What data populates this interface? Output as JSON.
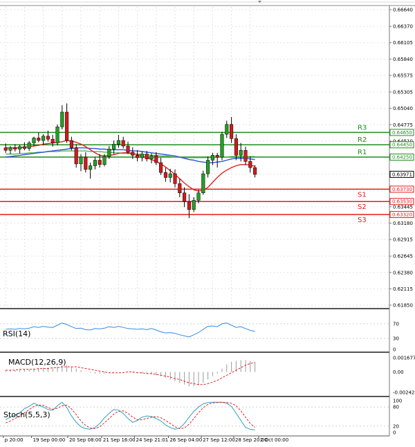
{
  "chart_data": {
    "type": "candlestick",
    "main": {
      "y_ticks": [
        "0.66640",
        "0.66370",
        "0.66105",
        "0.65840",
        "0.65575",
        "0.65305",
        "0.65040",
        "0.64775",
        "0.64510",
        "0.64245",
        "0.63975",
        "0.63710",
        "0.63445",
        "0.63180",
        "0.62915",
        "0.62645",
        "0.62380",
        "0.62115",
        "0.61850"
      ],
      "ylim": [
        0.6185,
        0.6664
      ],
      "current_price": "0.63971",
      "levels": [
        {
          "name": "R3",
          "value": 0.6465,
          "label": "0.64650",
          "color": "#1f8c1f"
        },
        {
          "name": "R2",
          "value": 0.6445,
          "label": "0.64450",
          "color": "#1f8c1f"
        },
        {
          "name": "R1",
          "value": 0.6425,
          "label": "0.64250",
          "color": "#1f8c1f"
        },
        {
          "name": "S1",
          "value": 0.6373,
          "label": "0.63730",
          "color": "#e31a1a"
        },
        {
          "name": "S2",
          "value": 0.6353,
          "label": "0.63530",
          "color": "#e31a1a"
        },
        {
          "name": "S3",
          "value": 0.6332,
          "label": "0.63320",
          "color": "#e31a1a"
        }
      ],
      "candles": [
        [
          0.644,
          0.6447,
          0.6432,
          0.6436
        ],
        [
          0.6436,
          0.6443,
          0.643,
          0.644
        ],
        [
          0.644,
          0.6446,
          0.6434,
          0.6438
        ],
        [
          0.6438,
          0.6445,
          0.6431,
          0.6442
        ],
        [
          0.6442,
          0.6449,
          0.6436,
          0.6439
        ],
        [
          0.6439,
          0.6451,
          0.6435,
          0.6448
        ],
        [
          0.6448,
          0.6458,
          0.6443,
          0.6456
        ],
        [
          0.6456,
          0.6465,
          0.6449,
          0.6452
        ],
        [
          0.6452,
          0.6462,
          0.6445,
          0.6459
        ],
        [
          0.6459,
          0.6468,
          0.645,
          0.6454
        ],
        [
          0.6454,
          0.6461,
          0.6442,
          0.6448
        ],
        [
          0.6448,
          0.6478,
          0.6444,
          0.6474
        ],
        [
          0.6474,
          0.6509,
          0.647,
          0.6498
        ],
        [
          0.6498,
          0.6512,
          0.6448,
          0.6452
        ],
        [
          0.6452,
          0.6458,
          0.6436,
          0.644
        ],
        [
          0.644,
          0.6446,
          0.6408,
          0.6414
        ],
        [
          0.6414,
          0.643,
          0.6402,
          0.6425
        ],
        [
          0.6425,
          0.6433,
          0.64,
          0.6405
        ],
        [
          0.6405,
          0.6416,
          0.639,
          0.6411
        ],
        [
          0.6411,
          0.6425,
          0.6405,
          0.642
        ],
        [
          0.642,
          0.643,
          0.6408,
          0.6413
        ],
        [
          0.6413,
          0.643,
          0.641,
          0.6426
        ],
        [
          0.6426,
          0.6443,
          0.6422,
          0.6438
        ],
        [
          0.6438,
          0.6452,
          0.643,
          0.6446
        ],
        [
          0.6446,
          0.6461,
          0.644,
          0.6452
        ],
        [
          0.6452,
          0.6458,
          0.6439,
          0.6443
        ],
        [
          0.6443,
          0.645,
          0.643,
          0.6433
        ],
        [
          0.6433,
          0.6441,
          0.6422,
          0.6428
        ],
        [
          0.6428,
          0.6436,
          0.6418,
          0.6424
        ],
        [
          0.6424,
          0.6434,
          0.6418,
          0.643
        ],
        [
          0.643,
          0.6435,
          0.6418,
          0.6422
        ],
        [
          0.6422,
          0.6431,
          0.6415,
          0.6427
        ],
        [
          0.6427,
          0.6433,
          0.6412,
          0.6416
        ],
        [
          0.6416,
          0.6424,
          0.6396,
          0.64
        ],
        [
          0.64,
          0.6408,
          0.6385,
          0.6392
        ],
        [
          0.6392,
          0.6406,
          0.6384,
          0.6398
        ],
        [
          0.6398,
          0.6405,
          0.6376,
          0.6382
        ],
        [
          0.6382,
          0.639,
          0.636,
          0.6367
        ],
        [
          0.6367,
          0.6376,
          0.6344,
          0.6353
        ],
        [
          0.6353,
          0.6365,
          0.6326,
          0.634
        ],
        [
          0.634,
          0.636,
          0.6336,
          0.6355
        ],
        [
          0.6355,
          0.6372,
          0.635,
          0.6367
        ],
        [
          0.6367,
          0.6403,
          0.6364,
          0.6398
        ],
        [
          0.6398,
          0.6426,
          0.6392,
          0.642
        ],
        [
          0.642,
          0.6432,
          0.6412,
          0.6428
        ],
        [
          0.6428,
          0.6432,
          0.6408,
          0.6425
        ],
        [
          0.6425,
          0.6466,
          0.642,
          0.6462
        ],
        [
          0.6462,
          0.6484,
          0.6456,
          0.6478
        ],
        [
          0.6478,
          0.649,
          0.6448,
          0.6455
        ],
        [
          0.6455,
          0.6462,
          0.642,
          0.6428
        ],
        [
          0.6428,
          0.6448,
          0.6418,
          0.6436
        ],
        [
          0.6436,
          0.6442,
          0.6412,
          0.6418
        ],
        [
          0.6418,
          0.6426,
          0.64,
          0.6408
        ],
        [
          0.6408,
          0.6412,
          0.6392,
          0.6397
        ]
      ],
      "ma_red": [
        0.644,
        0.644,
        0.644,
        0.644,
        0.6441,
        0.6442,
        0.6443,
        0.6444,
        0.6446,
        0.6447,
        0.6448,
        0.6449,
        0.645,
        0.6452,
        0.6451,
        0.6449,
        0.6446,
        0.6442,
        0.6437,
        0.6432,
        0.6428,
        0.6427,
        0.6428,
        0.6429,
        0.6431,
        0.6432,
        0.6432,
        0.6431,
        0.6429,
        0.6427,
        0.6424,
        0.6421,
        0.6418,
        0.6414,
        0.6409,
        0.6403,
        0.6397,
        0.639,
        0.6383,
        0.6377,
        0.6372,
        0.637,
        0.6371,
        0.6376,
        0.6384,
        0.6392,
        0.6399,
        0.6404,
        0.6408,
        0.6411,
        0.6413,
        0.6413,
        0.6412,
        0.641
      ],
      "ma_blue": [
        0.6425,
        0.6426,
        0.6427,
        0.6428,
        0.6429,
        0.643,
        0.6431,
        0.6432,
        0.6433,
        0.6434,
        0.6435,
        0.6436,
        0.6437,
        0.6438,
        0.6439,
        0.644,
        0.644,
        0.644,
        0.6439,
        0.6439,
        0.6438,
        0.6438,
        0.6437,
        0.6437,
        0.6437,
        0.6437,
        0.6436,
        0.6435,
        0.6435,
        0.6434,
        0.6433,
        0.6432,
        0.6431,
        0.643,
        0.6429,
        0.6428,
        0.6427,
        0.6425,
        0.6423,
        0.6421,
        0.642,
        0.6418,
        0.6417,
        0.6416,
        0.6416,
        0.6417,
        0.6418,
        0.642,
        0.6422,
        0.6423,
        0.6423,
        0.6423,
        0.6422,
        0.6421
      ],
      "ma_green": [
        0.643,
        0.643,
        0.643,
        0.6431,
        0.6431,
        0.6432,
        0.6432,
        0.6433,
        0.6433,
        0.6434,
        0.6434,
        0.6434,
        0.6435,
        0.6435,
        0.6435,
        0.6435,
        0.6435,
        0.6435,
        0.6434,
        0.6434,
        0.6434,
        0.6433,
        0.6433,
        0.6432,
        0.6432,
        0.6431,
        0.6431,
        0.643,
        0.643,
        0.6429,
        0.6429,
        0.6428,
        0.6428,
        0.6427,
        0.6427,
        0.6426,
        0.6425,
        0.6425,
        0.6424,
        0.6424,
        0.6424,
        0.6424,
        0.6424,
        0.6424,
        0.6424,
        0.6425,
        0.6425,
        0.6425,
        0.6426,
        0.6426,
        0.6426,
        0.6426,
        0.6426,
        0.6426
      ]
    },
    "rsi": {
      "label": "RSI(14)",
      "ticks": [
        "70",
        "30",
        "0"
      ],
      "ylim": [
        0,
        100
      ],
      "values": [
        55,
        56,
        55,
        57,
        56,
        58,
        62,
        60,
        63,
        61,
        60,
        66,
        72,
        68,
        62,
        57,
        58,
        54,
        53,
        57,
        56,
        58,
        62,
        60,
        63,
        60,
        57,
        56,
        55,
        56,
        54,
        57,
        53,
        48,
        45,
        46,
        44,
        40,
        37,
        34,
        40,
        46,
        55,
        63,
        64,
        62,
        70,
        72,
        66,
        60,
        62,
        57,
        52,
        49
      ]
    },
    "macd": {
      "label": "MACD(12,26,9)",
      "ticks": [
        "0.001677",
        "0.00",
        "-0.002421"
      ],
      "ylim": [
        -0.002421,
        0.001677
      ],
      "histogram": [
        0.0002,
        0.0002,
        0.0002,
        0.0003,
        0.0003,
        0.0003,
        0.0004,
        0.0004,
        0.0005,
        0.0005,
        0.0005,
        0.0006,
        0.0008,
        0.0008,
        0.0006,
        0.0004,
        0.0002,
        0.0,
        -0.0001,
        -0.0002,
        -0.0002,
        -0.0002,
        -0.0001,
        -0.0001,
        0.0,
        0.0,
        0.0,
        -0.0001,
        -0.0001,
        -0.0002,
        -0.0002,
        -0.0003,
        -0.0004,
        -0.0005,
        -0.0007,
        -0.0009,
        -0.0011,
        -0.0013,
        -0.0015,
        -0.0017,
        -0.0017,
        -0.0016,
        -0.0013,
        -0.0009,
        -0.0005,
        -0.0002,
        0.0004,
        0.0009,
        0.0012,
        0.0013,
        0.0014,
        0.0014,
        0.0013,
        0.0012
      ],
      "signal": [
        0.0002,
        0.0002,
        0.0002,
        0.0003,
        0.0003,
        0.0003,
        0.0003,
        0.0004,
        0.0004,
        0.0004,
        0.0005,
        0.0005,
        0.0006,
        0.0006,
        0.0006,
        0.0006,
        0.0005,
        0.0004,
        0.0003,
        0.0002,
        0.0001,
        0.0,
        -0.0001,
        -0.0001,
        -0.0001,
        -0.0001,
        0.0,
        0.0,
        -0.0001,
        -0.0001,
        -0.0002,
        -0.0002,
        -0.0003,
        -0.0004,
        -0.0005,
        -0.0006,
        -0.0008,
        -0.0009,
        -0.0011,
        -0.0013,
        -0.0014,
        -0.0015,
        -0.0015,
        -0.0014,
        -0.0012,
        -0.001,
        -0.0007,
        -0.0004,
        -0.0001,
        0.0002,
        0.0005,
        0.0008,
        0.001,
        0.0011
      ]
    },
    "stoch": {
      "label": "Stoch(5,5,3)",
      "ticks": [
        "100",
        "80",
        "20",
        "0"
      ],
      "ylim": [
        0,
        100
      ],
      "main": [
        40,
        48,
        55,
        62,
        75,
        82,
        92,
        85,
        80,
        72,
        70,
        84,
        95,
        78,
        52,
        32,
        18,
        12,
        10,
        16,
        28,
        46,
        60,
        72,
        70,
        60,
        44,
        32,
        38,
        48,
        52,
        50,
        44,
        36,
        24,
        15,
        10,
        14,
        28,
        48,
        66,
        80,
        90,
        94,
        95,
        95,
        95,
        92,
        82,
        60,
        38,
        16,
        10,
        8
      ],
      "signal": [
        30,
        36,
        44,
        52,
        62,
        72,
        82,
        86,
        85,
        78,
        73,
        76,
        84,
        86,
        74,
        56,
        36,
        22,
        14,
        12,
        18,
        30,
        44,
        58,
        66,
        68,
        60,
        48,
        40,
        40,
        44,
        48,
        50,
        46,
        38,
        28,
        18,
        12,
        14,
        26,
        44,
        62,
        78,
        88,
        93,
        94,
        95,
        94,
        92,
        84,
        68,
        48,
        28,
        16
      ]
    },
    "x_labels": [
      {
        "index": -0.5,
        "text": "p 20:00"
      },
      {
        "index": 5.5,
        "text": "19 Sep 00:00"
      },
      {
        "index": 13.2,
        "text": "20 Sep 08:00"
      },
      {
        "index": 20.4,
        "text": "21 Sep 16:00"
      },
      {
        "index": 27.4,
        "text": "24 Sep 21:01"
      },
      {
        "index": 34.6,
        "text": "26 Sep 04:00"
      },
      {
        "index": 41.6,
        "text": "27 Sep 12:00"
      },
      {
        "index": 48.5,
        "text": "28 Sep 20:00"
      },
      {
        "index": 53.8,
        "text": "2 Oct 00:00"
      }
    ]
  }
}
